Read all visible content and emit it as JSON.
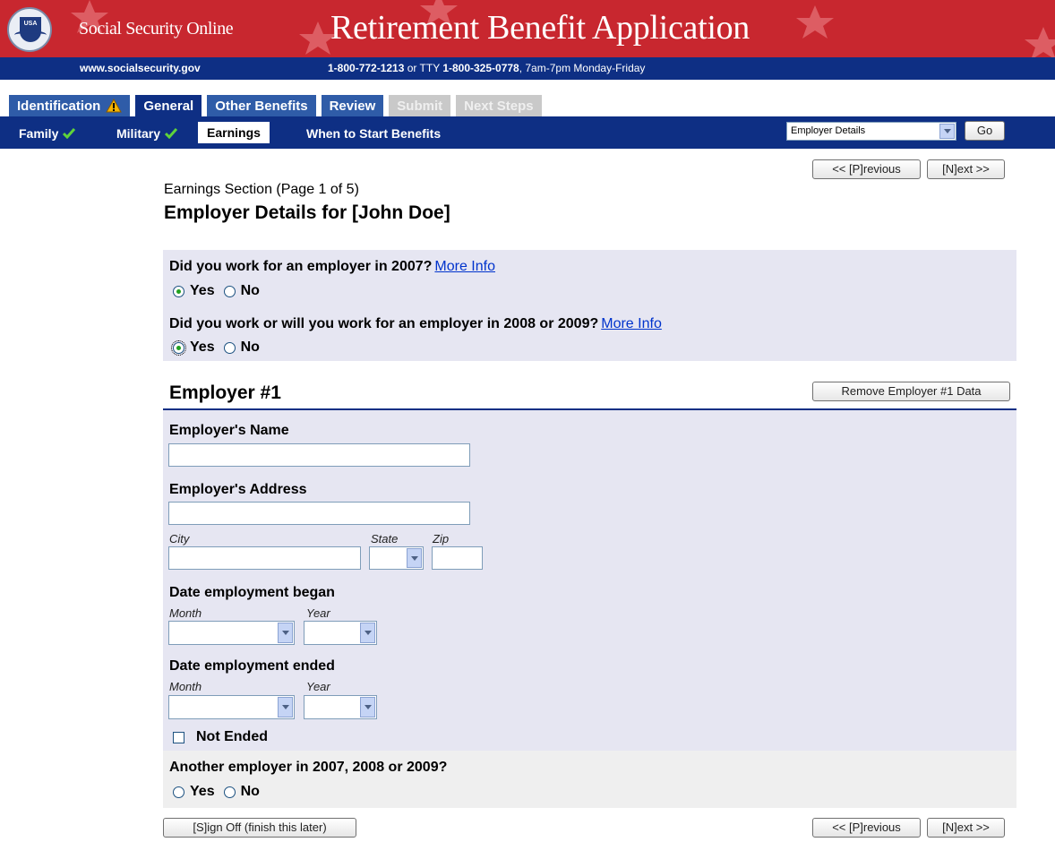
{
  "header": {
    "site_name": "Social Security Online",
    "app_title": "Retirement Benefit Application",
    "seal_text": "USA",
    "url": "www.socialsecurity.gov",
    "phone_primary": "1-800-772-1213",
    "phone_or_tty": " or TTY ",
    "phone_tty": "1-800-325-0778",
    "phone_hours": ", 7am-7pm Monday-Friday",
    "colors": {
      "banner": "#c8272f",
      "navy": "#0e2f84",
      "tab_blue": "#2f5ca8"
    }
  },
  "tabs": [
    {
      "label": "Identification",
      "state": "warning"
    },
    {
      "label": "General",
      "state": "current"
    },
    {
      "label": "Other Benefits",
      "state": "enabled"
    },
    {
      "label": "Review",
      "state": "enabled"
    },
    {
      "label": "Submit",
      "state": "disabled"
    },
    {
      "label": "Next Steps",
      "state": "disabled"
    }
  ],
  "subnav": {
    "items": [
      {
        "label": "Family",
        "complete": true
      },
      {
        "label": "Military",
        "complete": true
      },
      {
        "label": "Earnings",
        "current": true
      },
      {
        "label": "When to Start Benefits"
      }
    ],
    "jump_select_value": "Employer Details",
    "go_label": "Go"
  },
  "pager": {
    "previous_label": "<< [P]revious",
    "next_label": "[N]ext >>"
  },
  "page": {
    "section": "Earnings Section (Page 1 of 5)",
    "title": "Employer Details for [John Doe]"
  },
  "questions": [
    {
      "text": "Did you work for an employer in 2007?",
      "more_info": "More Info",
      "yes": "Yes",
      "no": "No",
      "selected": "Yes"
    },
    {
      "text": "Did you work or will you work for an employer in 2008 or 2009?",
      "more_info": "More Info",
      "yes": "Yes",
      "no": "No",
      "selected": "Yes"
    }
  ],
  "employer": {
    "header": "Employer #1",
    "remove_label": "Remove Employer #1 Data",
    "name_label": "Employer's Name",
    "name_value": "",
    "address_label": "Employer's Address",
    "address_value": "",
    "city_label": "City",
    "state_label": "State",
    "zip_label": "Zip",
    "began_label": "Date employment began",
    "ended_label": "Date employment ended",
    "month_label": "Month",
    "year_label": "Year",
    "not_ended_label": "Not Ended",
    "not_ended_checked": false
  },
  "another": {
    "question": "Another employer in 2007, 2008 or 2009?",
    "yes": "Yes",
    "no": "No",
    "selected": null
  },
  "signoff_label": "[S]ign Off (finish this later)"
}
